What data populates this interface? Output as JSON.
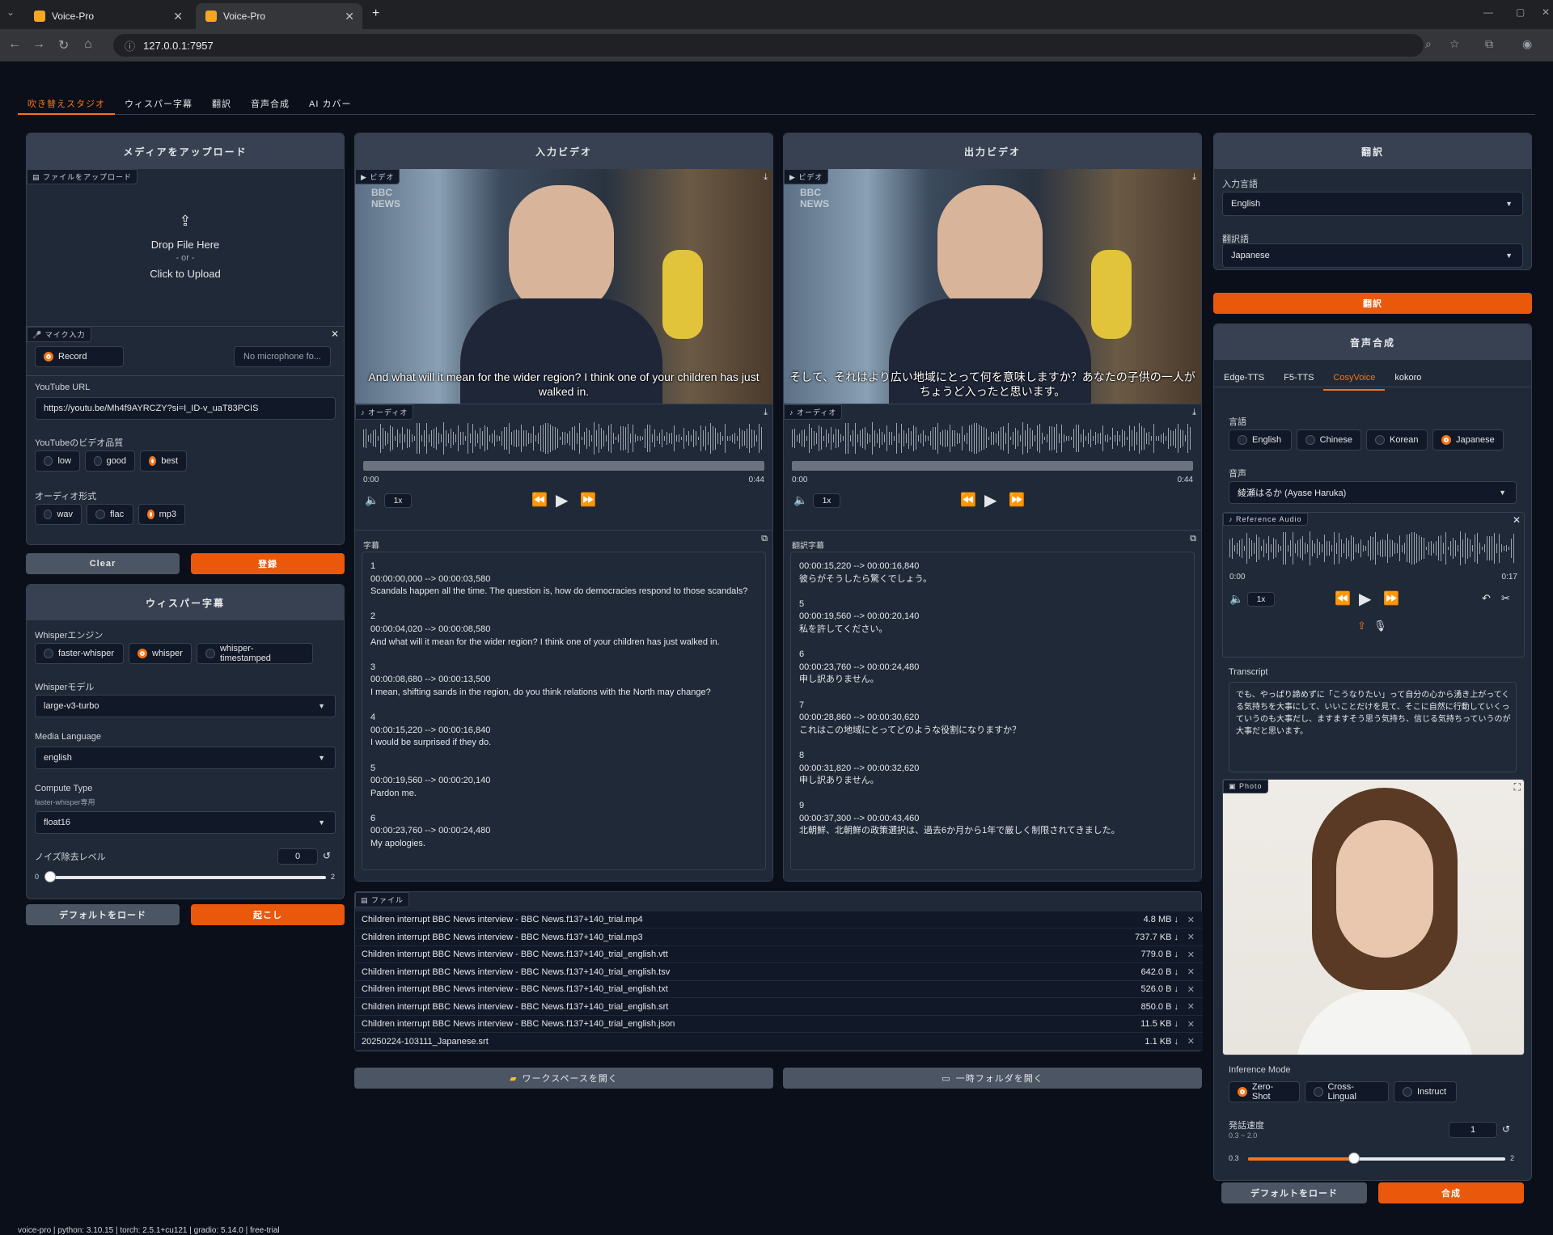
{
  "browser": {
    "tabs": [
      "Voice-Pro",
      "Voice-Pro"
    ],
    "url": "127.0.0.1:7957"
  },
  "maintabs": [
    "吹き替えスタジオ",
    "ウィスパー字幕",
    "翻訳",
    "音声合成",
    "AI カバー"
  ],
  "upload": {
    "title": "メディアをアップロード",
    "file_label": "ファイルをアップロード",
    "drop": "Drop File Here",
    "or": "- or -",
    "click": "Click to Upload",
    "mic_label": "マイク入力",
    "record": "Record",
    "no_mic": "No microphone fo...",
    "yt_label": "YouTube URL",
    "yt_value": "https://youtu.be/Mh4f9AYRCZY?si=I_ID-v_uaT83PCIS",
    "quality_label": "YouTubeのビデオ品質",
    "quality": [
      "low",
      "good",
      "best"
    ],
    "format_label": "オーディオ形式",
    "formats": [
      "wav",
      "flac",
      "mp3"
    ],
    "clear": "Clear",
    "submit": "登録"
  },
  "whisper": {
    "title": "ウィスパー字幕",
    "engine_label": "Whisperエンジン",
    "engines": [
      "faster-whisper",
      "whisper",
      "whisper-timestamped"
    ],
    "model_label": "Whisperモデル",
    "model": "large-v3-turbo",
    "lang_label": "Media Language",
    "lang": "english",
    "compute_label": "Compute Type",
    "compute_sub": "faster-whisper専用",
    "compute": "float16",
    "noise_label": "ノイズ除去レベル",
    "noise_value": "0",
    "noise_min": "0",
    "noise_max": "2",
    "default_btn": "デフォルトをロード",
    "run_btn": "起こし"
  },
  "input_video": {
    "title": "入力ビデオ",
    "video_label": "ビデオ",
    "caption": "And what will it mean for the wider region? I think one of your children has just walked in.",
    "audio_label": "オーディオ",
    "t0": "0:00",
    "t1": "0:44",
    "speed": "1x",
    "subs_label": "字幕",
    "subs": "1\n00:00:00,000 --> 00:00:03,580\nScandals happen all the time. The question is, how do democracies respond to those scandals?\n\n2\n00:00:04,020 --> 00:00:08,580\nAnd what will it mean for the wider region? I think one of your children has just walked in.\n\n3\n00:00:08,680 --> 00:00:13,500\nI mean, shifting sands in the region, do you think relations with the North may change?\n\n4\n00:00:15,220 --> 00:00:16,840\nI would be surprised if they do.\n\n5\n00:00:19,560 --> 00:00:20,140\nPardon me.\n\n6\n00:00:23,760 --> 00:00:24,480\nMy apologies."
  },
  "output_video": {
    "title": "出力ビデオ",
    "video_label": "ビデオ",
    "caption": "そして、それはより広い地域にとって何を意味しますか？あなたの子供の一人がちょうど入ったと思います。",
    "audio_label": "オーディオ",
    "t0": "0:00",
    "t1": "0:44",
    "speed": "1x",
    "subs_label": "翻訳字幕",
    "subs": "00:00:15,220 --> 00:00:16,840\n彼らがそうしたら驚くでしょう。\n\n5\n00:00:19,560 --> 00:00:20,140\n私を許してください。\n\n6\n00:00:23,760 --> 00:00:24,480\n申し訳ありません。\n\n7\n00:00:28,860 --> 00:00:30,620\nこれはこの地域にとってどのような役割になりますか？\n\n8\n00:00:31,820 --> 00:00:32,620\n申し訳ありません。\n\n9\n00:00:37,300 --> 00:00:43,460\n北朝鮮、北朝鮮の政策選択は、過去6か月から1年で厳しく制限されてきました。"
  },
  "files": {
    "label": "ファイル",
    "rows": [
      [
        "Children interrupt BBC News interview - BBC News.f137+140_trial.mp4",
        "4.8 MB ↓"
      ],
      [
        "Children interrupt BBC News interview - BBC News.f137+140_trial.mp3",
        "737.7 KB ↓"
      ],
      [
        "Children interrupt BBC News interview - BBC News.f137+140_trial_english.vtt",
        "779.0 B ↓"
      ],
      [
        "Children interrupt BBC News interview - BBC News.f137+140_trial_english.tsv",
        "642.0 B ↓"
      ],
      [
        "Children interrupt BBC News interview - BBC News.f137+140_trial_english.txt",
        "526.0 B ↓"
      ],
      [
        "Children interrupt BBC News interview - BBC News.f137+140_trial_english.srt",
        "850.0 B ↓"
      ],
      [
        "Children interrupt BBC News interview - BBC News.f137+140_trial_english.json",
        "11.5 KB ↓"
      ],
      [
        "20250224-103111_Japanese.srt",
        "1.1 KB ↓"
      ]
    ],
    "open_ws": "ワークスペースを開く",
    "open_tmp": "一時フォルダを開く"
  },
  "translate": {
    "title": "翻訳",
    "in_label": "入力言語",
    "in_value": "English",
    "out_label": "翻訳語",
    "out_value": "Japanese",
    "btn": "翻訳"
  },
  "tts": {
    "title": "音声合成",
    "tabs": [
      "Edge-TTS",
      "F5-TTS",
      "CosyVoice",
      "kokoro"
    ],
    "lang_label": "言語",
    "langs": [
      "English",
      "Chinese",
      "Korean",
      "Japanese"
    ],
    "voice_label": "音声",
    "voice": "綾瀬はるか (Ayase Haruka)",
    "ref_label": "Reference Audio",
    "t0": "0:00",
    "t1": "0:17",
    "speed": "1x",
    "transcript_label": "Transcript",
    "transcript": "でも、やっぱり諦めずに「こうなりたい」って自分の心から湧き上がってくる気持ちを大事にして、いいことだけを見て、そこに自然に行動していくっていうのも大事だし、ますますそう思う気持ち、信じる気持ちっていうのが大事だと思います。",
    "photo_label": "Photo",
    "mode_label": "Inference Mode",
    "modes": [
      "Zero-Shot",
      "Cross-Lingual",
      "Instruct"
    ],
    "rate_label": "発話速度",
    "rate_range": "0.3 ~ 2.0",
    "rate_value": "1",
    "rate_min": "0.3",
    "rate_max": "2",
    "default_btn": "デフォルトをロード",
    "run_btn": "合成"
  },
  "footer": "voice-pro | python: 3.10.15 | torch: 2.5.1+cu121 | gradio: 5.14.0 | free-trial",
  "colors": {
    "accent": "#ea580c",
    "bg": "#0b0f19",
    "panel": "#1f2937"
  }
}
